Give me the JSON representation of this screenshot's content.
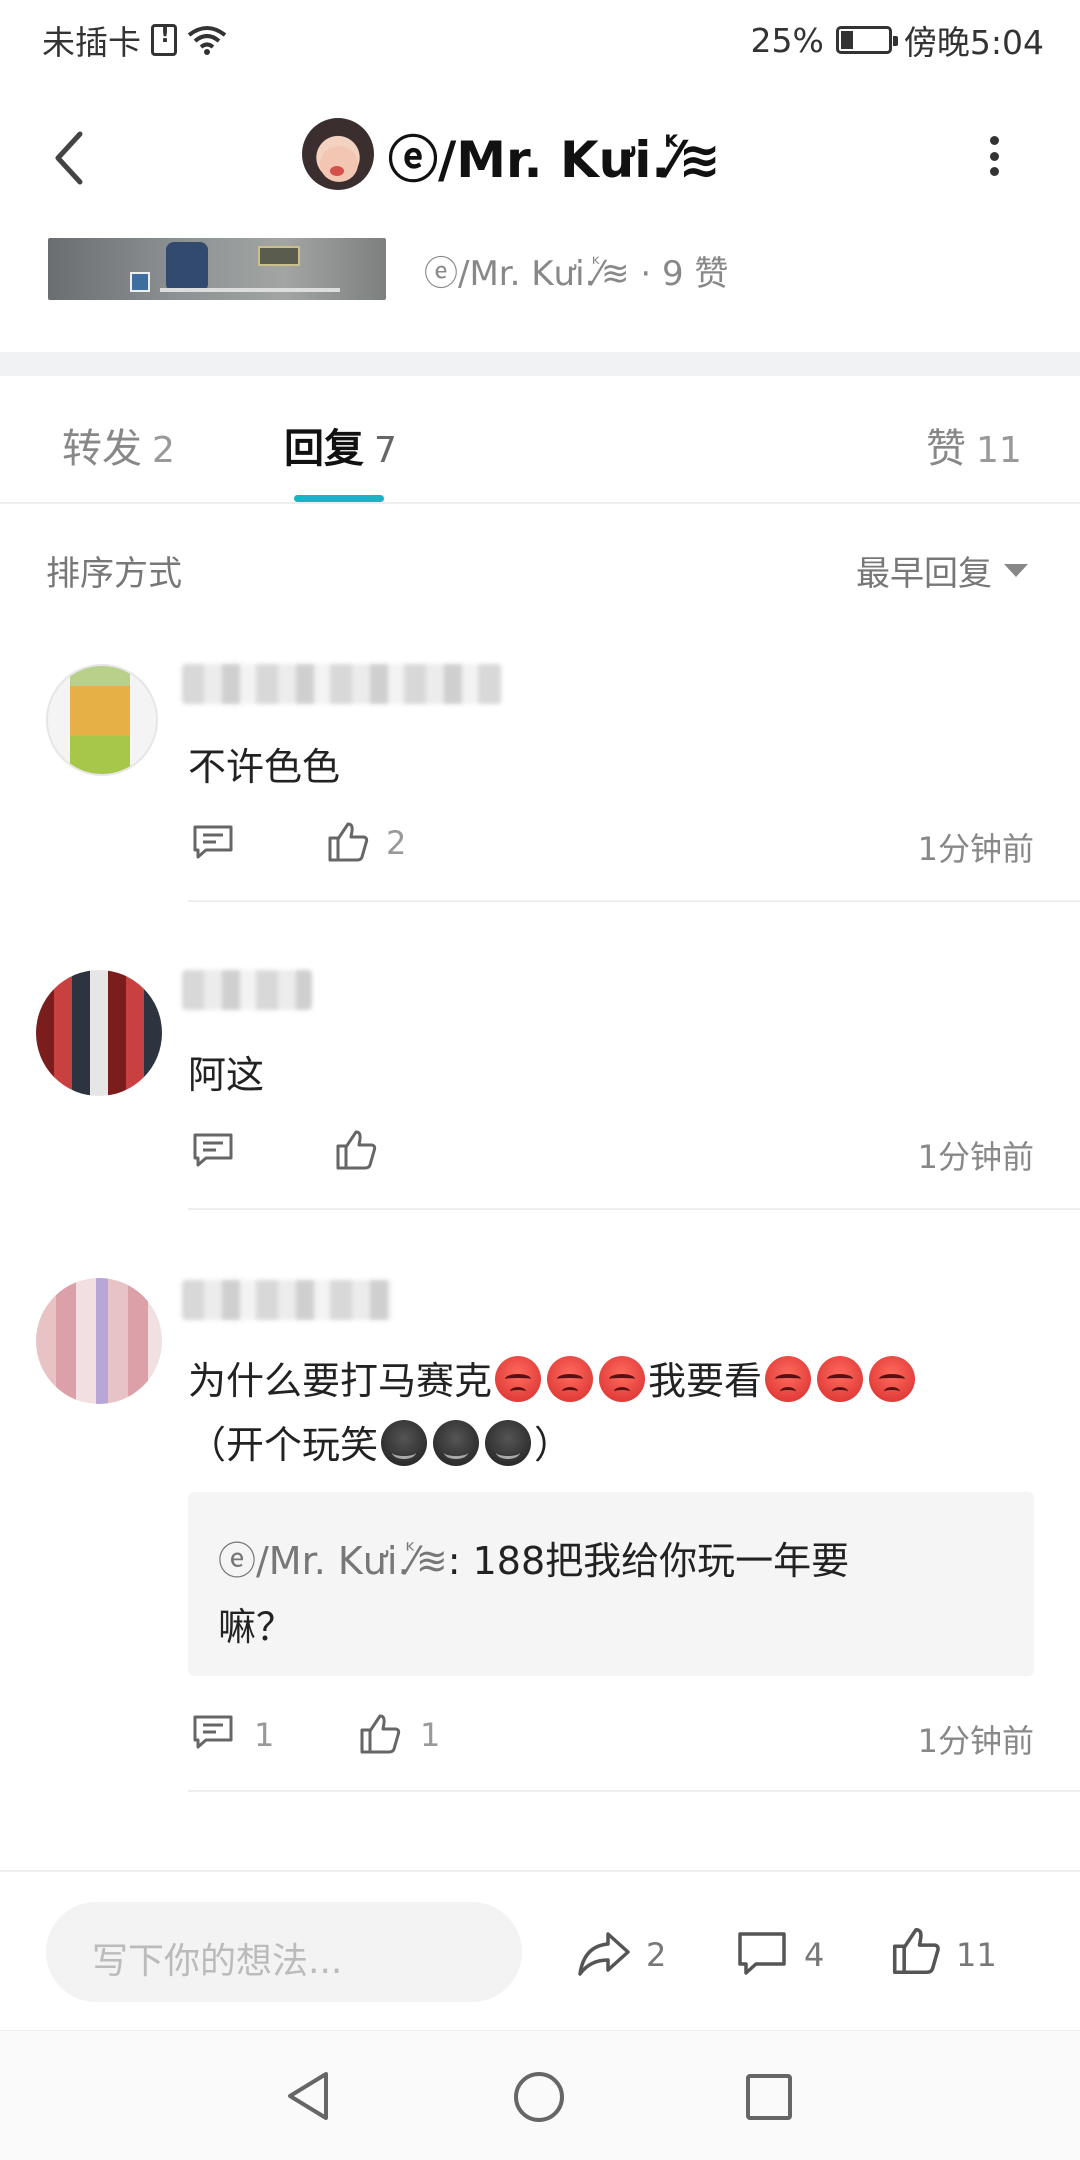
{
  "status_bar": {
    "carrier": "未插卡",
    "battery_percent": "25%",
    "time": "傍晚5:04"
  },
  "header": {
    "title": "ⓔ/Mr. Kưi.ⷦ⁄≋"
  },
  "post": {
    "author": "ⓔ/Mr. Kưi.ⷦ⁄≋",
    "likes": "· 9 赞"
  },
  "tabs": [
    {
      "label": "转发",
      "count": "2"
    },
    {
      "label": "回复",
      "count": "7"
    },
    {
      "label": "赞",
      "count": "11"
    }
  ],
  "sort": {
    "label": "排序方式",
    "value": "最早回复"
  },
  "comments": [
    {
      "text": "不许色色",
      "likes": "2",
      "replies": "",
      "time": "1分钟前"
    },
    {
      "text": "阿这",
      "likes": "",
      "replies": "",
      "time": "1分钟前"
    },
    {
      "text_line1": "为什么要打马赛克",
      "text_mid": "我要看",
      "text_line2_start": "（开个玩笑",
      "text_line2_end": "）",
      "reply_author": "ⓔ/Mr. Kưi.ⷦ⁄≋",
      "reply_text_line1": ": 188把我给你玩一年要",
      "reply_text_line2": "嘛？",
      "replies": "1",
      "likes": "1",
      "time": "1分钟前"
    }
  ],
  "bottom_bar": {
    "input_placeholder": "写下你的想法...",
    "share_count": "2",
    "comment_count": "4",
    "like_count": "11"
  },
  "icons": {
    "back": "chevron-left-icon",
    "more": "more-vertical-icon",
    "comment": "comment-icon",
    "like": "thumbs-up-icon",
    "share": "share-icon",
    "dropdown": "caret-down-icon",
    "nav_back": "triangle-back-icon",
    "nav_home": "circle-home-icon",
    "nav_recent": "square-recent-icon"
  },
  "colors": {
    "accent": "#1ab3c3",
    "angry_emoji": "#e03a35"
  }
}
